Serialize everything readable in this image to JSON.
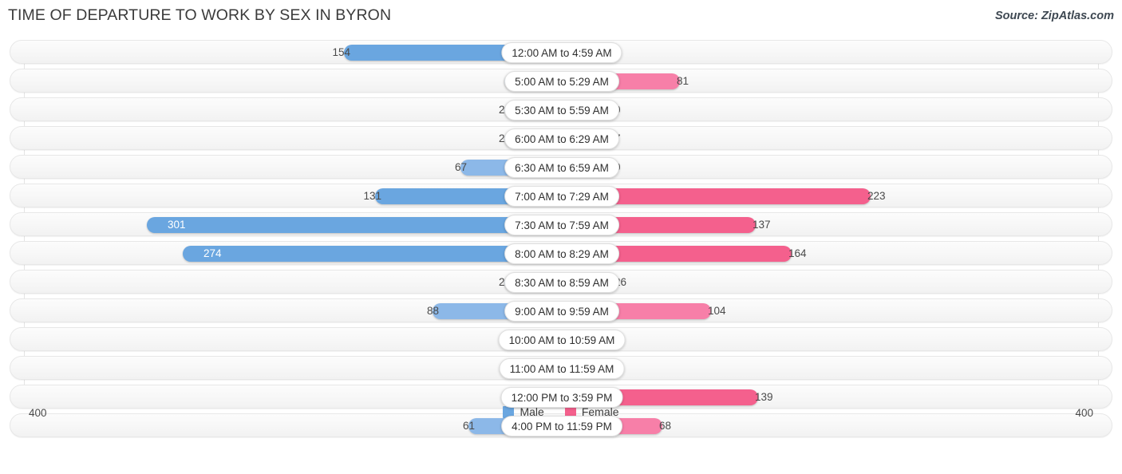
{
  "header": {
    "title": "TIME OF DEPARTURE TO WORK BY SEX IN BYRON",
    "source": "Source: ZipAtlas.com"
  },
  "legend": {
    "male_label": "Male",
    "female_label": "Female",
    "male_color": "#6aa6e0",
    "female_color": "#f4608d"
  },
  "axis": {
    "left_label": "400",
    "right_label": "400"
  },
  "chart_data": {
    "type": "bar",
    "orientation": "horizontal-diverging",
    "title": "TIME OF DEPARTURE TO WORK BY SEX IN BYRON",
    "xlabel": "",
    "ylabel": "",
    "xlim": [
      400,
      400
    ],
    "axis_max": 400,
    "grid": true,
    "legend_position": "bottom-center",
    "categories": [
      "12:00 AM to 4:59 AM",
      "5:00 AM to 5:29 AM",
      "5:30 AM to 5:59 AM",
      "6:00 AM to 6:29 AM",
      "6:30 AM to 6:59 AM",
      "7:00 AM to 7:29 AM",
      "7:30 AM to 7:59 AM",
      "8:00 AM to 8:29 AM",
      "8:30 AM to 8:59 AM",
      "9:00 AM to 9:59 AM",
      "10:00 AM to 10:59 AM",
      "11:00 AM to 11:59 AM",
      "12:00 PM to 3:59 PM",
      "4:00 PM to 11:59 PM"
    ],
    "series": [
      {
        "name": "Male",
        "color": "#6aa6e0",
        "values": [
          154,
          0,
          22,
          23,
          67,
          131,
          301,
          274,
          29,
          88,
          0,
          0,
          0,
          61
        ]
      },
      {
        "name": "Female",
        "color": "#f4608d",
        "values": [
          0,
          81,
          0,
          7,
          0,
          223,
          137,
          164,
          26,
          104,
          0,
          0,
          139,
          68
        ]
      }
    ]
  },
  "rows": [
    {
      "label": "12:00 AM to 4:59 AM",
      "male": "154",
      "female": "0"
    },
    {
      "label": "5:00 AM to 5:29 AM",
      "male": "0",
      "female": "81"
    },
    {
      "label": "5:30 AM to 5:59 AM",
      "male": "22",
      "female": "0"
    },
    {
      "label": "6:00 AM to 6:29 AM",
      "male": "23",
      "female": "7"
    },
    {
      "label": "6:30 AM to 6:59 AM",
      "male": "67",
      "female": "0"
    },
    {
      "label": "7:00 AM to 7:29 AM",
      "male": "131",
      "female": "223"
    },
    {
      "label": "7:30 AM to 7:59 AM",
      "male": "301",
      "female": "137"
    },
    {
      "label": "8:00 AM to 8:29 AM",
      "male": "274",
      "female": "164"
    },
    {
      "label": "8:30 AM to 8:59 AM",
      "male": "29",
      "female": "26"
    },
    {
      "label": "9:00 AM to 9:59 AM",
      "male": "88",
      "female": "104"
    },
    {
      "label": "10:00 AM to 10:59 AM",
      "male": "0",
      "female": "0"
    },
    {
      "label": "11:00 AM to 11:59 AM",
      "male": "0",
      "female": "0"
    },
    {
      "label": "12:00 PM to 3:59 PM",
      "male": "0",
      "female": "139"
    },
    {
      "label": "4:00 PM to 11:59 PM",
      "male": "61",
      "female": "68"
    }
  ]
}
